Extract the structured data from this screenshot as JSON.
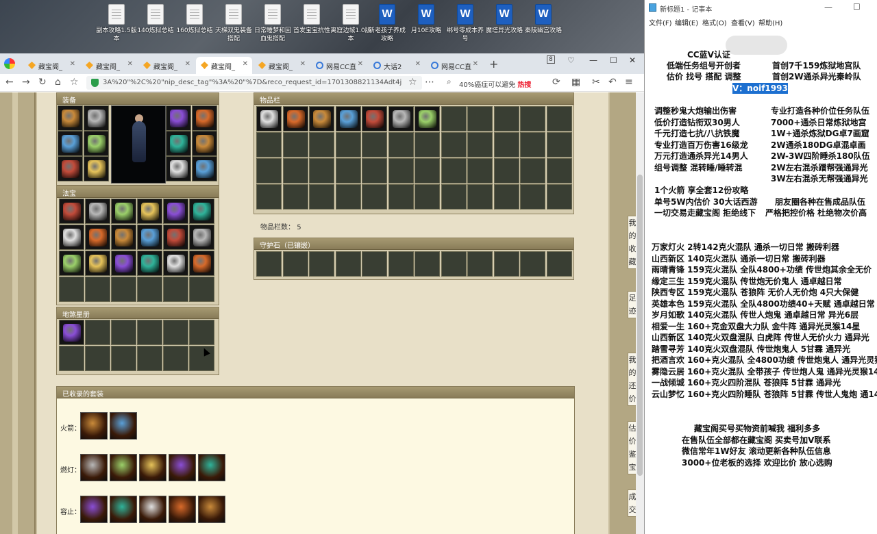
{
  "desktop": {
    "icons": [
      {
        "label": "副本攻略1.5版本",
        "type": "txt"
      },
      {
        "label": "140炼狱总结",
        "type": "txt"
      },
      {
        "label": "160炼狱总结",
        "type": "txt"
      },
      {
        "label": "天梯双鬼装备搭配",
        "type": "txt"
      },
      {
        "label": "日常睡梦和回血鬼搭配",
        "type": "txt"
      },
      {
        "label": "首发宝宝抗性",
        "type": "txt"
      },
      {
        "label": "离窟边城1.0版本",
        "type": "txt"
      },
      {
        "label": "新老孩子养成攻略",
        "type": "doc"
      },
      {
        "label": "月10E攻略",
        "type": "doc"
      },
      {
        "label": "绑号零成本养号",
        "type": "doc"
      },
      {
        "label": "魔塔异光攻略",
        "type": "doc"
      },
      {
        "label": "秦陵幽宫攻略",
        "type": "doc"
      }
    ]
  },
  "browser": {
    "tabs": [
      {
        "label": "藏宝阁_",
        "icon": "tbg-icon",
        "active": false
      },
      {
        "label": "藏宝阁_",
        "icon": "tbg-icon",
        "active": false
      },
      {
        "label": "藏宝阁_",
        "icon": "tbg-icon",
        "active": false
      },
      {
        "label": "藏宝阁_",
        "icon": "tbg-icon",
        "active": true
      },
      {
        "label": "藏宝阁_",
        "icon": "tbg-icon",
        "active": false
      },
      {
        "label": "网易CC直",
        "icon": "globe-icon",
        "active": false
      },
      {
        "label": "大话2",
        "icon": "globe-icon",
        "active": false
      },
      {
        "label": "网易CC直",
        "icon": "globe-icon",
        "active": false
      }
    ],
    "tab_count": "8",
    "url": "3A%20\"%2C%20\"nip_desc_tag\"%3A%20\"%7D&reco_request_id=1701308821134Adt4j",
    "search_text": "40%癌症可以避免",
    "search_hot": "热搜"
  },
  "game": {
    "equip_title": "装备",
    "fabao_title": "法宝",
    "book_title": "地煞星册",
    "items_title": "物品栏",
    "items_count_label": "物品栏数：",
    "items_count": "5",
    "guard_title": "守护石（已镶嵌）",
    "collected_title": "已收录的套装",
    "rows": [
      {
        "label": "火箭：",
        "count": 2
      },
      {
        "label": "燃灯：",
        "count": 5
      },
      {
        "label": "容止：",
        "count": 5
      }
    ],
    "side_notes": [
      [
        "我",
        "的",
        "收",
        "藏"
      ],
      [
        "足",
        "迹"
      ],
      [
        "我",
        "的",
        "还",
        "价"
      ],
      [
        "估",
        "价",
        "鉴",
        "宝"
      ],
      [
        "成",
        "交"
      ]
    ]
  },
  "notepad": {
    "title": "新标题1 - 记事本",
    "menu": [
      "文件(F)",
      "编辑(E)",
      "格式(O)",
      "查看(V)",
      "帮助(H)"
    ],
    "header": [
      "CC蓝V认证",
      "低端任务组号开创者",
      "首创7千159炼狱地宫队",
      "估价 找号 搭配 调整",
      "首创2W通杀异光秦岭队",
      "V：noif1993"
    ],
    "services_left": [
      "调整秒鬼大炮输出伤害",
      "低价打造钻衔双30男人",
      "千元打造七抗/八抗铁魔",
      "专业打造百万伤害16级龙",
      "万元打造通杀异光14男人",
      "组号调整 混转睡/睡转混"
    ],
    "services_right": [
      "专业打造各种价位任务队伍",
      "7000+通杀日常炼狱地宫",
      "1W+通杀炼狱DG卓7画窟",
      "2W通杀180DG卓混卓画",
      "2W-3W四阶睡杀180队伍",
      "2W左右混杀蹭帮强通异光",
      "3W左右混杀无帮强通异光"
    ],
    "promo": [
      "1个火箭 享全套12份攻略",
      "单号5W内估价 30大话西游",
      "朋友圈各种在售成品队伍",
      "一切交易走藏宝阁 拒绝线下",
      "严格把控价格 杜绝物次价高"
    ],
    "listings": [
      "万家灯火 2转142克火混队 通杀一切日常 搬砖利器",
      "山西新区 140克火混队 通杀一切日常 搬砖利器",
      "雨晴青锋 159克火混队 全队4800+功绩 传世炮其余全无价",
      "缘定三生 159克火混队 传世炮无价鬼人 通卓越日常",
      "陕西专区 159克火混队 苍狼阵 无价人无价炮 4只大保健",
      "英雄本色 159克火混队 全队4800功绩40+天赋 通卓越日常",
      "岁月如歌 140克火混队 传世人炮鬼 通卓越日常 异光6层",
      "相爱一生 160+克金双盘大力队 金牛阵 通异光灵猴14星",
      "山西新区 140克火双盘混队 白虎阵 传世人无价火力 通异光",
      "踏雪寻芳 140克火双盘混队 传世炮鬼人 5甘霖 通异光",
      "把酒言欢 160+克火混队 全4800功绩 传世炮鬼人 通异光灵猴",
      "雾隐云居 160+克火混队 全带孩子 传世炮人鬼 通异光灵猴14",
      "一战倾城 160+克火四阶混队 苍狼阵 5甘霖 通异光",
      "云山梦忆 160+克火四阶睡队 苍狼阵 5甘霖 传世人鬼炮 通14"
    ],
    "footer": [
      "藏宝阁买号买物资前喊我 福利多多",
      "在售队伍全部都在藏宝阁 买卖号加V联系",
      "微信常年1W好友 滚动更新各种队伍信息",
      "3000+位老板的选择 欢迎比价 放心选购"
    ]
  }
}
